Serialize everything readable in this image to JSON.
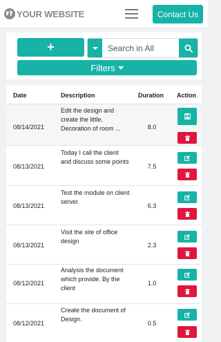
{
  "header": {
    "logo_text": "YOUR WEBSITE",
    "contact_label": "Contact Us"
  },
  "toolbar": {
    "add_label": "+",
    "search_placeholder": "Search in All",
    "filters_label": "Filters"
  },
  "table": {
    "columns": [
      "Date",
      "Description",
      "Duration",
      "Action"
    ],
    "rows": [
      {
        "date": "08/14/2021",
        "description": "Edit the design and create the little. Decoration of room ...",
        "duration": "8.0"
      },
      {
        "date": "08/13/2021",
        "description": "Today I call the client and discuss some points",
        "duration": "7.5"
      },
      {
        "date": "08/13/2021",
        "description": "Test the module on client server.",
        "duration": "6.3"
      },
      {
        "date": "08/13/2021",
        "description": "Visit the site of office design",
        "duration": "2.3"
      },
      {
        "date": "08/12/2021",
        "description": "Analysis the document which provide. By the client",
        "duration": "1.0"
      },
      {
        "date": "08/12/2021",
        "description": "Create the document of Design.",
        "duration": "0.5"
      }
    ]
  },
  "colors": {
    "accent": "#16b3a6",
    "danger": "#e0163e"
  },
  "icons": {
    "logo": "globe-icon",
    "menu": "hamburger-icon",
    "search": "search-icon",
    "save": "save-icon",
    "edit": "edit-icon",
    "delete": "trash-icon"
  }
}
